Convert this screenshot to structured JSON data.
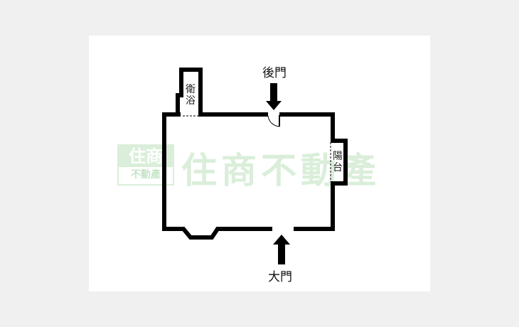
{
  "watermark": {
    "text": "住商不動產",
    "logo_top": "住商",
    "logo_bottom": "不動產",
    "color": "#96cd96"
  },
  "rooms": {
    "bathroom": "衛浴",
    "balcony": "陽台"
  },
  "doors": {
    "back_door": "後門",
    "front_door": "大門"
  },
  "colors": {
    "wall": "#000000",
    "background": "#ffffff"
  }
}
